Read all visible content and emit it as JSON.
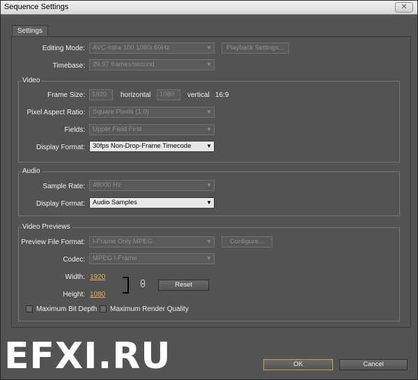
{
  "window": {
    "title": "Sequence Settings",
    "close_glyph": "✕"
  },
  "tabs": [
    {
      "label": "Settings"
    }
  ],
  "general": {
    "editing_mode_label": "Editing Mode:",
    "editing_mode_value": "AVC-Intra 100 1080i 60Hz",
    "playback_settings_button": "Playback Settings...",
    "timebase_label": "Timebase:",
    "timebase_value": "29,97 frames/second"
  },
  "video": {
    "title": "Video",
    "frame_size_label": "Frame Size:",
    "frame_width": "1920",
    "horizontal_label": "horizontal",
    "frame_height": "1080",
    "vertical_label": "vertical",
    "aspect": "16:9",
    "pixel_aspect_label": "Pixel Aspect Ratio:",
    "pixel_aspect_value": "Square Pixels (1.0)",
    "fields_label": "Fields:",
    "fields_value": "Upper Field First",
    "display_format_label": "Display Format:",
    "display_format_value": "30fps Non-Drop-Frame Timecode"
  },
  "audio": {
    "title": "Audio",
    "sample_rate_label": "Sample Rate:",
    "sample_rate_value": "48000 Hz",
    "display_format_label": "Display Format:",
    "display_format_value": "Audio Samples"
  },
  "previews": {
    "title": "Video Previews",
    "file_format_label": "Preview File Format:",
    "file_format_value": "I-Frame Only MPEG",
    "configure_button": "Configure...",
    "codec_label": "Codec:",
    "codec_value": "MPEG I-Frame",
    "width_label": "Width:",
    "width_value": "1920",
    "height_label": "Height:",
    "height_value": "1080",
    "reset_button": "Reset",
    "max_bit_depth_label": "Maximum Bit Depth",
    "max_render_quality_label": "Maximum Render Quality"
  },
  "footer": {
    "ok": "OK",
    "cancel": "Cancel"
  },
  "watermark": "EFXI.RU",
  "icons": {
    "dropdown_arrow": "▼"
  },
  "colors": {
    "accent": "#e8b34a",
    "ok_border": "#c9a240"
  }
}
